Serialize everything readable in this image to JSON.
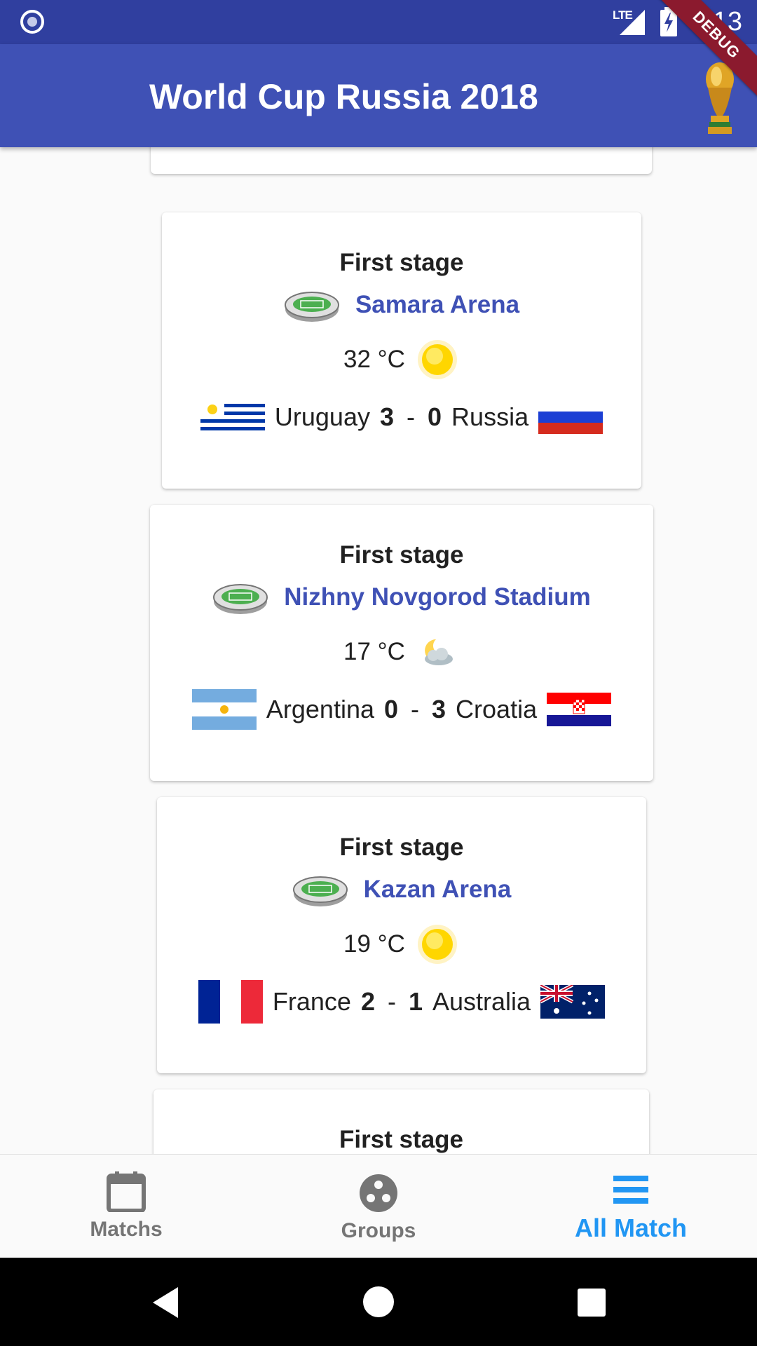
{
  "status_bar": {
    "time": "9:13",
    "network": "LTE",
    "colors": {
      "background": "#303f9f"
    }
  },
  "app_bar": {
    "title": "World Cup Russia 2018",
    "icon": "trophy-icon",
    "debug_banner": "DEBUG",
    "colors": {
      "background": "#3f51b5",
      "debug": "#8b1a2e"
    }
  },
  "matches": [
    {
      "stage": "First stage",
      "stadium": "Samara Arena",
      "temperature": "32 °C",
      "weather_icon": "sunny-icon",
      "home_team": "Uruguay",
      "home_score": "3",
      "separator": "-",
      "away_score": "0",
      "away_team": "Russia",
      "home_flag": "uruguay-flag-icon",
      "away_flag": "russia-flag-icon"
    },
    {
      "stage": "First stage",
      "stadium": "Nizhny Novgorod Stadium",
      "temperature": "17 °C",
      "weather_icon": "partly-cloudy-night-icon",
      "home_team": "Argentina",
      "home_score": "0",
      "separator": "-",
      "away_score": "3",
      "away_team": "Croatia",
      "home_flag": "argentina-flag-icon",
      "away_flag": "croatia-flag-icon"
    },
    {
      "stage": "First stage",
      "stadium": "Kazan Arena",
      "temperature": "19 °C",
      "weather_icon": "sunny-icon",
      "home_team": "France",
      "home_score": "2",
      "separator": "-",
      "away_score": "1",
      "away_team": "Australia",
      "home_flag": "france-flag-icon",
      "away_flag": "australia-flag-icon"
    },
    {
      "stage": "First stage"
    }
  ],
  "bottom_nav": {
    "items": [
      {
        "label": "Matchs",
        "icon": "calendar-icon",
        "active": false
      },
      {
        "label": "Groups",
        "icon": "groups-icon",
        "active": false
      },
      {
        "label": "All Match",
        "icon": "list-icon",
        "active": true
      }
    ],
    "colors": {
      "active": "#2196f3",
      "inactive": "#757575"
    }
  },
  "system_nav": {
    "buttons": [
      "back-icon",
      "home-icon",
      "recents-icon"
    ]
  }
}
